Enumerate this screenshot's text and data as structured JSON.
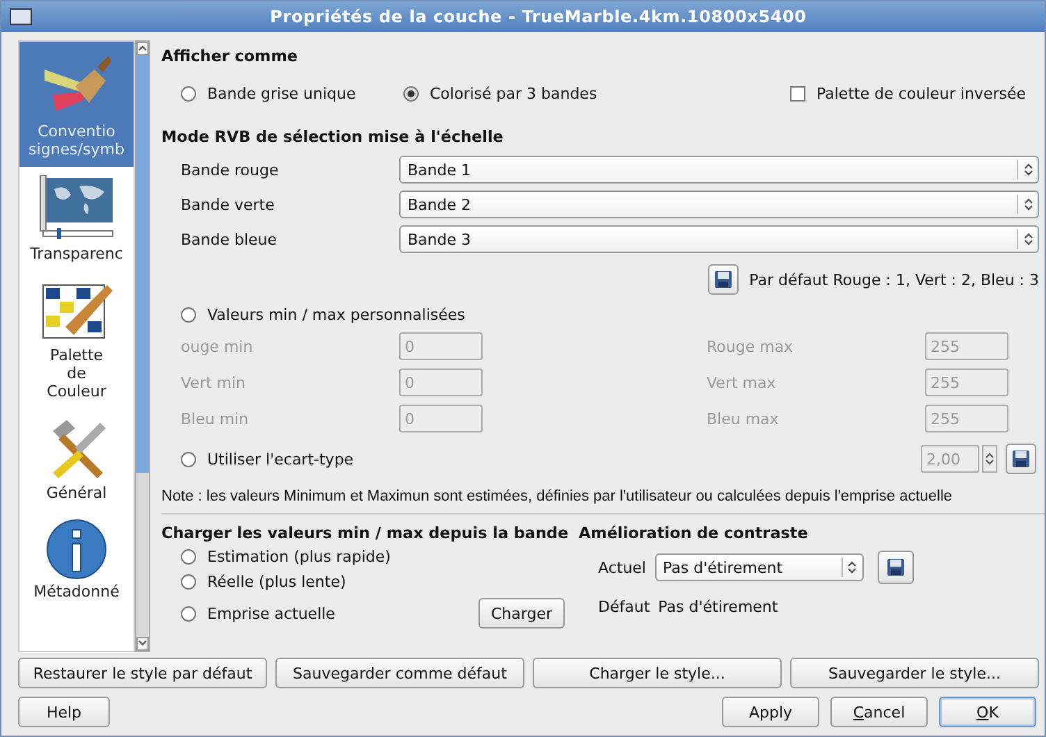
{
  "window": {
    "title": "Propriétés de la couche - TrueMarble.4km.10800x5400"
  },
  "sidebar": {
    "items": [
      {
        "kind": "brush",
        "lines": [
          "Conventio",
          "signes/symb"
        ],
        "selected": true
      },
      {
        "kind": "map",
        "lines": [
          "Transparenc"
        ],
        "selected": false
      },
      {
        "kind": "grid",
        "lines": [
          "Palette",
          "de",
          "Couleur"
        ],
        "selected": false
      },
      {
        "kind": "tools",
        "lines": [
          "Général"
        ],
        "selected": false
      },
      {
        "kind": "info",
        "lines": [
          "Métadonné"
        ],
        "selected": false
      }
    ]
  },
  "display_as": {
    "heading": "Afficher comme",
    "options": [
      {
        "label": "Bande grise unique",
        "selected": false
      },
      {
        "label": "Colorisé par 3 bandes",
        "selected": true
      }
    ],
    "invert_palette": {
      "label": "Palette de couleur inversée",
      "checked": false
    }
  },
  "rgb_mode": {
    "heading": "Mode RVB de sélection mise à l'échelle",
    "bands": [
      {
        "label": "Bande rouge",
        "value": "Bande 1"
      },
      {
        "label": "Bande verte",
        "value": "Bande 2"
      },
      {
        "label": "Bande bleue",
        "value": "Bande 3"
      }
    ],
    "default_text": "Par défaut Rouge : 1, Vert : 2, Bleu : 3"
  },
  "custom_minmax": {
    "label": "Valeurs min / max personnalisées",
    "selected": false,
    "disabled": true,
    "rows": [
      {
        "min_label": "ouge min",
        "min_value": "0",
        "max_label": "Rouge max",
        "max_value": "255"
      },
      {
        "min_label": "Vert min",
        "min_value": "0",
        "max_label": "Vert max",
        "max_value": "255"
      },
      {
        "min_label": "Bleu min",
        "min_value": "0",
        "max_label": "Bleu max",
        "max_value": "255"
      }
    ]
  },
  "std_dev": {
    "label": "Utiliser l'ecart-type",
    "selected": false,
    "value": "2,00"
  },
  "note": "Note : les valeurs Minimum et Maximun sont estimées, définies par l'utilisateur ou calculées depuis l'emprise actuelle",
  "load": {
    "heading": "Charger les valeurs min / max depuis la bande",
    "options": [
      {
        "label": "Estimation (plus rapide)",
        "selected": false
      },
      {
        "label": "Réelle (plus lente)",
        "selected": false
      },
      {
        "label": "Emprise actuelle",
        "selected": false
      }
    ],
    "button": "Charger"
  },
  "contrast": {
    "heading": "Amélioration de contraste",
    "current_label": "Actuel",
    "current_value": "Pas d'étirement",
    "default_label": "Défaut",
    "default_value": "Pas d'étirement"
  },
  "style_buttons": [
    "Restaurer le style par défaut",
    "Sauvegarder comme défaut",
    "Charger le style...",
    "Sauvegarder le style..."
  ],
  "buttons": [
    {
      "label": "Help",
      "mnemonic": false,
      "default": false
    },
    {
      "label": "Apply",
      "mnemonic": false,
      "default": false
    },
    {
      "label": "Cancel",
      "mnemonic": true,
      "default": false
    },
    {
      "label": "OK",
      "mnemonic": true,
      "default": true
    }
  ]
}
